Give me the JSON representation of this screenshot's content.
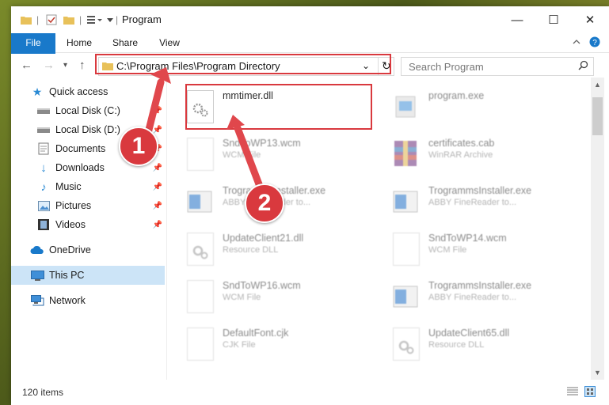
{
  "window": {
    "title": "Program",
    "controls": {
      "minimize": "—",
      "maximize": "☐",
      "close": "✕"
    }
  },
  "ribbon": {
    "tabs": [
      "File",
      "Home",
      "Share",
      "View"
    ]
  },
  "address": {
    "path": "C:\\Program Files\\Program Directory",
    "search_placeholder": "Search Program"
  },
  "sidebar": {
    "items": [
      {
        "label": "Quick access",
        "icon": "star-icon",
        "pinned": false
      },
      {
        "label": "Local Disk (C:)",
        "icon": "drive-icon",
        "pinned": true
      },
      {
        "label": "Local Disk (D:)",
        "icon": "drive-icon",
        "pinned": true
      },
      {
        "label": "Documents",
        "icon": "documents-icon",
        "pinned": true
      },
      {
        "label": "Downloads",
        "icon": "download-icon",
        "pinned": true
      },
      {
        "label": "Music",
        "icon": "music-icon",
        "pinned": true
      },
      {
        "label": "Pictures",
        "icon": "pictures-icon",
        "pinned": true
      },
      {
        "label": "Videos",
        "icon": "videos-icon",
        "pinned": true
      },
      {
        "label": "OneDrive",
        "icon": "cloud-icon",
        "pinned": false
      },
      {
        "label": "This PC",
        "icon": "pc-icon",
        "pinned": false
      },
      {
        "label": "Network",
        "icon": "network-icon",
        "pinned": false
      }
    ]
  },
  "files": [
    {
      "name": "mmtimer.dll",
      "type": ""
    },
    {
      "name": "program.exe",
      "type": ""
    },
    {
      "name": "SndToWP13.wcm",
      "type": "WCM File"
    },
    {
      "name": "certificates.cab",
      "type": "WinRAR Archive"
    },
    {
      "name": "TrogrammsInstaller.exe",
      "type": "ABBY FineReader to..."
    },
    {
      "name": "TrogrammsInstaller.exe",
      "type": "ABBY FineReader to..."
    },
    {
      "name": "UpdateClient21.dll",
      "type": "Resource DLL"
    },
    {
      "name": "SndToWP14.wcm",
      "type": "WCM File"
    },
    {
      "name": "SndToWP16.wcm",
      "type": "WCM File"
    },
    {
      "name": "TrogrammsInstaller.exe",
      "type": "ABBY FineReader to..."
    },
    {
      "name": "DefaultFont.cjk",
      "type": "CJK File"
    },
    {
      "name": "UpdateClient65.dll",
      "type": "Resource DLL"
    }
  ],
  "status": {
    "item_count": "120 items"
  },
  "callouts": [
    "1",
    "2"
  ],
  "colors": {
    "highlight": "#d9393e",
    "accent": "#1979ca",
    "selected": "#cce4f7"
  }
}
